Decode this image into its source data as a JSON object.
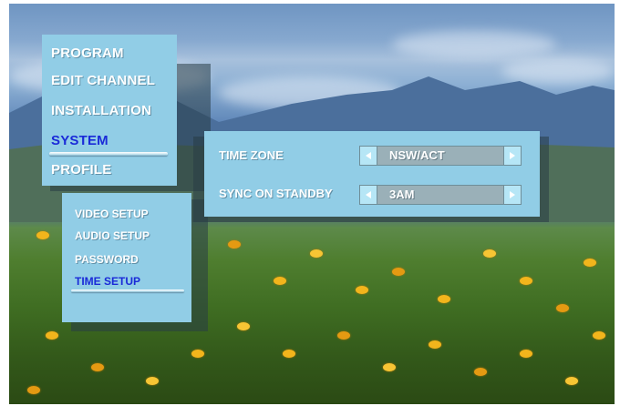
{
  "main_menu": {
    "items": [
      {
        "label": "PROGRAM"
      },
      {
        "label": "EDIT CHANNEL"
      },
      {
        "label": "INSTALLATION"
      },
      {
        "label": "SYSTEM",
        "selected": true
      },
      {
        "label": "PROFILE"
      }
    ]
  },
  "system_submenu": {
    "items": [
      {
        "label": "VIDEO SETUP"
      },
      {
        "label": "AUDIO SETUP"
      },
      {
        "label": "PASSWORD"
      },
      {
        "label": "TIME SETUP",
        "selected": true
      }
    ]
  },
  "time_setup": {
    "rows": [
      {
        "label": "TIME ZONE",
        "value": "NSW/ACT"
      },
      {
        "label": "SYNC ON STANDBY",
        "value": "3AM"
      }
    ]
  },
  "colors": {
    "panel": "#91cde6",
    "selected_text": "#1a2ad8",
    "selector_body": "#9ab0b8",
    "selector_arrow": "#b6e6f6"
  },
  "icons": {
    "decrement": "left-triangle-icon",
    "increment": "right-triangle-icon"
  }
}
